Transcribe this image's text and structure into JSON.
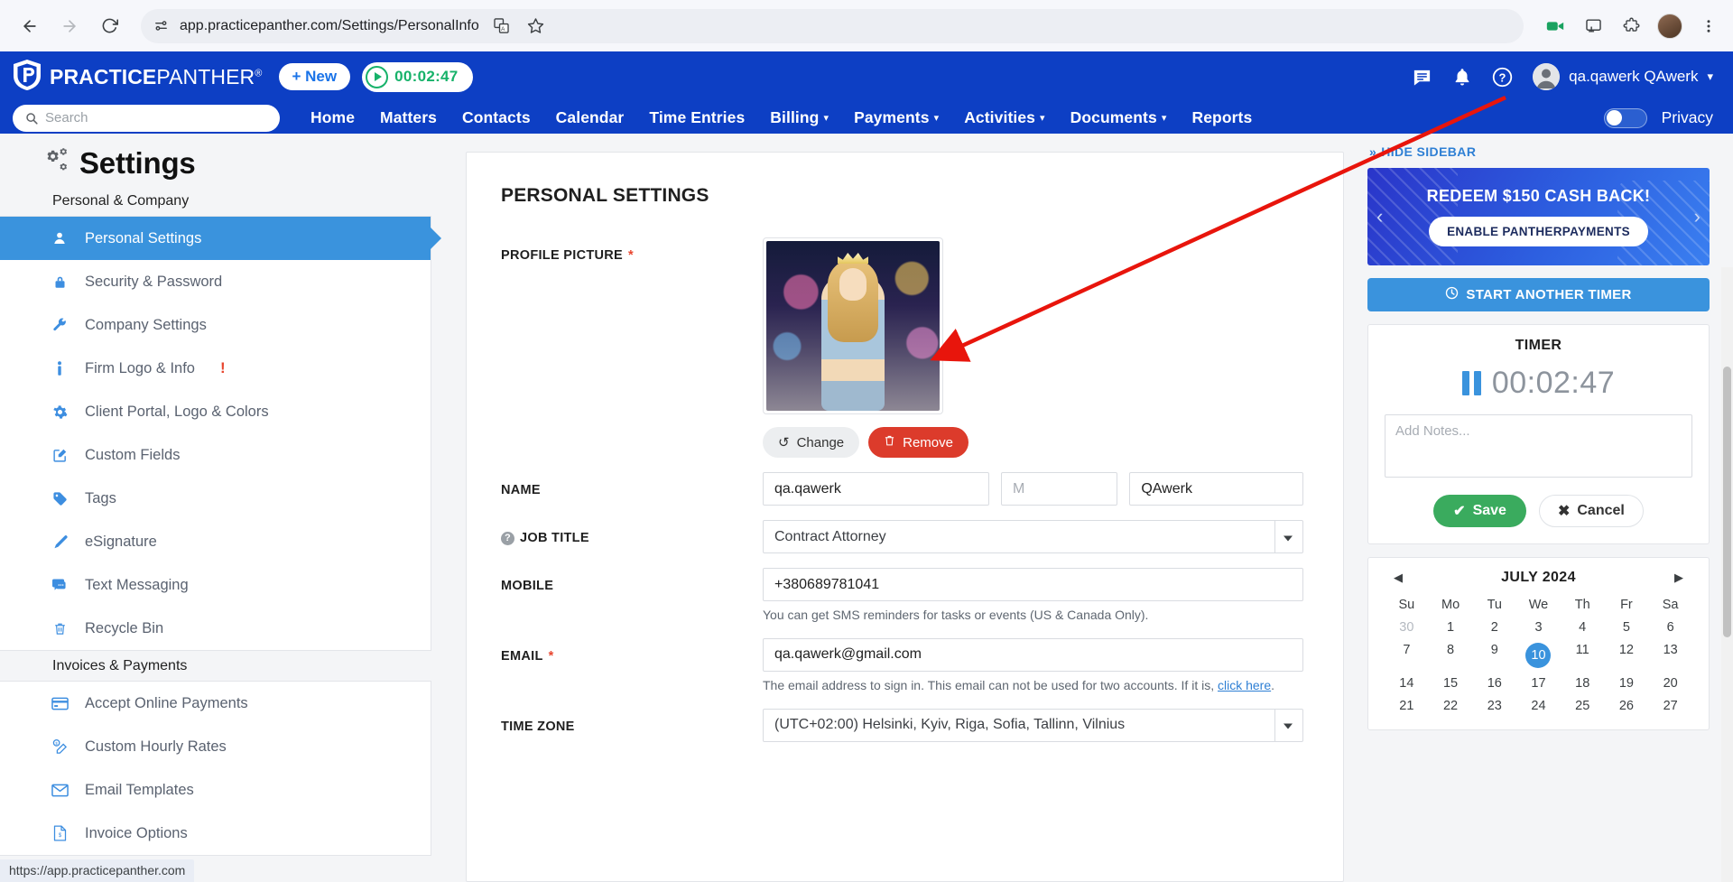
{
  "browser": {
    "url": "app.practicepanther.com/Settings/PersonalInfo",
    "back_title": "Back",
    "forward_title": "Forward",
    "reload_title": "Reload",
    "site_info_title": "View site information",
    "translate_title": "Translate this page",
    "bookmark_title": "Bookmark this tab",
    "record_title": "Screen recorder",
    "cast_title": "Cast",
    "extensions_title": "Extensions",
    "profile_title": "Profile",
    "menu_title": "Customize and control Chrome",
    "status_url": "https://app.practicepanther.com"
  },
  "header": {
    "logo_bold": "PRACTICE",
    "logo_light": "PANTHER",
    "logo_reg": "®",
    "new_button": "+ New",
    "timer_value": "00:02:47",
    "search_placeholder": "Search",
    "nav": [
      {
        "label": "Home",
        "caret": false
      },
      {
        "label": "Matters",
        "caret": false
      },
      {
        "label": "Contacts",
        "caret": false
      },
      {
        "label": "Calendar",
        "caret": false
      },
      {
        "label": "Time Entries",
        "caret": false
      },
      {
        "label": "Billing",
        "caret": true
      },
      {
        "label": "Payments",
        "caret": true
      },
      {
        "label": "Activities",
        "caret": true
      },
      {
        "label": "Documents",
        "caret": true
      },
      {
        "label": "Reports",
        "caret": false
      }
    ],
    "user_name": "qa.qawerk QAwerk",
    "privacy_label": "Privacy",
    "messages_icon": "chat-icon",
    "bell_icon": "bell-icon",
    "help_icon": "help-icon"
  },
  "settings": {
    "page_title": "Settings",
    "groups": [
      {
        "label": "Personal & Company",
        "items": [
          {
            "label": "Personal Settings",
            "icon": "user-icon",
            "active": true,
            "badge": ""
          },
          {
            "label": "Security & Password",
            "icon": "lock-icon",
            "active": false,
            "badge": ""
          },
          {
            "label": "Company Settings",
            "icon": "wrench-icon",
            "active": false,
            "badge": ""
          },
          {
            "label": "Firm Logo & Info",
            "icon": "info-icon",
            "active": false,
            "badge": "!"
          },
          {
            "label": "Client Portal, Logo & Colors",
            "icon": "gear-icon",
            "active": false,
            "badge": ""
          },
          {
            "label": "Custom Fields",
            "icon": "edit-square-icon",
            "active": false,
            "badge": ""
          },
          {
            "label": "Tags",
            "icon": "tag-icon",
            "active": false,
            "badge": ""
          },
          {
            "label": "eSignature",
            "icon": "pen-icon",
            "active": false,
            "badge": ""
          },
          {
            "label": "Text Messaging",
            "icon": "message-icon",
            "active": false,
            "badge": ""
          },
          {
            "label": "Recycle Bin",
            "icon": "trash-icon",
            "active": false,
            "badge": ""
          }
        ]
      },
      {
        "label": "Invoices & Payments",
        "items": [
          {
            "label": "Accept Online Payments",
            "icon": "credit-card-icon",
            "active": false,
            "badge": ""
          },
          {
            "label": "Custom Hourly Rates",
            "icon": "rate-edit-icon",
            "active": false,
            "badge": ""
          },
          {
            "label": "Email Templates",
            "icon": "envelope-icon",
            "active": false,
            "badge": ""
          },
          {
            "label": "Invoice Options",
            "icon": "invoice-icon",
            "active": false,
            "badge": ""
          }
        ]
      }
    ]
  },
  "form": {
    "title": "PERSONAL SETTINGS",
    "profile_picture_label": "PROFILE PICTURE",
    "profile_picture_required": "*",
    "change_button": "Change",
    "remove_button": "Remove",
    "name_label": "NAME",
    "first_name": "qa.qawerk",
    "middle_placeholder": "M",
    "last_name": "QAwerk",
    "job_title_label": "JOB TITLE",
    "job_title_value": "Contract Attorney",
    "mobile_label": "MOBILE",
    "mobile_value": "+380689781041",
    "mobile_hint": "You can get SMS reminders for tasks or events (US & Canada Only).",
    "email_label": "EMAIL",
    "email_required": "*",
    "email_value": "qa.qawerk@gmail.com",
    "email_hint_pre": "The email address to sign in. This email can not be used for two accounts. If it is, ",
    "email_hint_link": "click here",
    "email_hint_post": ".",
    "timezone_label": "TIME ZONE",
    "timezone_value": "(UTC+02:00) Helsinki, Kyiv, Riga, Sofia, Tallinn, Vilnius"
  },
  "sidebar": {
    "hide_label": "HIDE SIDEBAR",
    "promo_title": "REDEEM $150 CASH BACK!",
    "promo_button": "ENABLE PANTHERPAYMENTS",
    "start_timer": "START ANOTHER TIMER",
    "timer_panel_title": "TIMER",
    "timer_digits": "00:02:47",
    "notes_placeholder": "Add Notes...",
    "save_label": "Save",
    "cancel_label": "Cancel",
    "calendar": {
      "month": "JULY 2024",
      "prev": "◀",
      "next": "▶",
      "dow": [
        "Su",
        "Mo",
        "Tu",
        "We",
        "Th",
        "Fr",
        "Sa"
      ],
      "weeks": [
        [
          {
            "d": "30",
            "muted": true
          },
          {
            "d": "1"
          },
          {
            "d": "2"
          },
          {
            "d": "3"
          },
          {
            "d": "4"
          },
          {
            "d": "5"
          },
          {
            "d": "6"
          }
        ],
        [
          {
            "d": "7"
          },
          {
            "d": "8"
          },
          {
            "d": "9"
          },
          {
            "d": "10",
            "today": true
          },
          {
            "d": "11"
          },
          {
            "d": "12"
          },
          {
            "d": "13"
          }
        ],
        [
          {
            "d": "14"
          },
          {
            "d": "15"
          },
          {
            "d": "16"
          },
          {
            "d": "17"
          },
          {
            "d": "18"
          },
          {
            "d": "19"
          },
          {
            "d": "20"
          }
        ],
        [
          {
            "d": "21"
          },
          {
            "d": "22"
          },
          {
            "d": "23"
          },
          {
            "d": "24"
          },
          {
            "d": "25"
          },
          {
            "d": "26"
          },
          {
            "d": "27"
          }
        ]
      ]
    }
  },
  "colors": {
    "brand_blue": "#0d3fc4",
    "accent_blue": "#3a93dd",
    "danger_red": "#dc3b2b",
    "success_green": "#3aab5e",
    "timer_green": "#17b26a",
    "annotation_red": "#e8150c"
  }
}
